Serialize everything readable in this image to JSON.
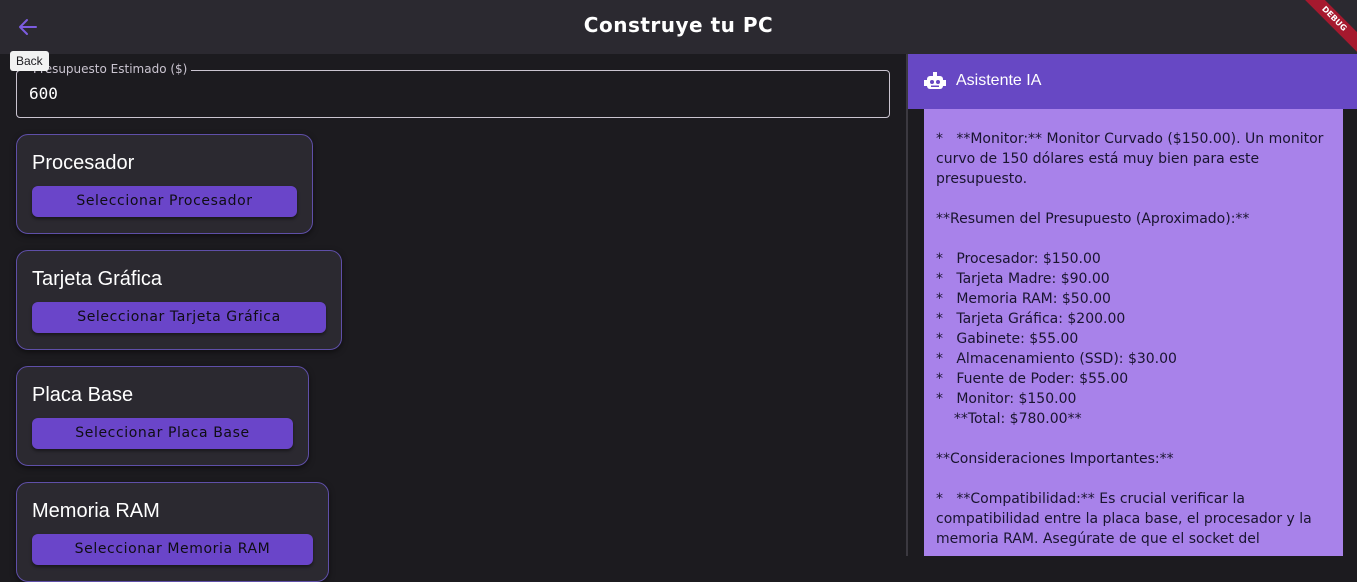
{
  "app_bar": {
    "title": "Construye tu PC",
    "debug_banner": "DEBUG"
  },
  "tooltip": {
    "text": "Back"
  },
  "budget": {
    "label": "Presupuesto Estimado ($)",
    "value": "600"
  },
  "components": [
    {
      "title": "Procesador",
      "button": "Seleccionar Procesador"
    },
    {
      "title": "Tarjeta Gráfica",
      "button": "Seleccionar Tarjeta Gráfica"
    },
    {
      "title": "Placa Base",
      "button": "Seleccionar Placa Base"
    },
    {
      "title": "Memoria RAM",
      "button": "Seleccionar Memoria RAM"
    }
  ],
  "assistant": {
    "title": "Asistente IA",
    "text": "Gabinete\n\n*   **Monitor:** Monitor Curvado ($150.00). Un monitor curvo de 150 dólares está muy bien para este presupuesto.\n\n**Resumen del Presupuesto (Aproximado):**\n\n*   Procesador: $150.00\n*   Tarjeta Madre: $90.00\n*   Memoria RAM: $50.00\n*   Tarjeta Gráfica: $200.00\n*   Gabinete: $55.00\n*   Almacenamiento (SSD): $30.00\n*   Fuente de Poder: $55.00\n*   Monitor: $150.00\n    **Total: $780.00**\n\n**Consideraciones Importantes:**\n\n*   **Compatibilidad:** Es crucial verificar la compatibilidad entre la placa base, el procesador y la memoria RAM. Asegúrate de que el socket del"
  },
  "colors": {
    "accent": "#6748c4",
    "panel": "#a882ea",
    "button": "#6a45c9",
    "background": "#1c1b1f"
  }
}
